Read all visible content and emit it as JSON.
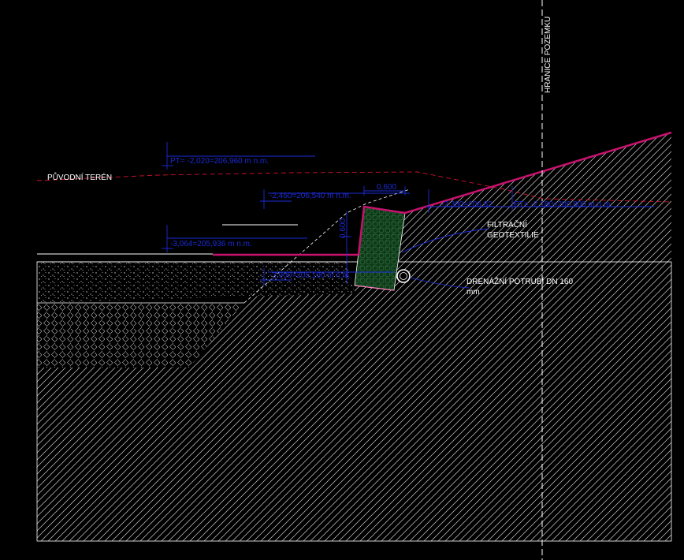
{
  "labels": {
    "boundary": "HRANICE POZEMKU",
    "original_terrain": "PŮVODNÍ TERÉN",
    "filter_line1": "FILTRAČNÍ",
    "filter_line2": "GEOTEXTILIE",
    "drain_line1": "DRENÁŽNÍ POTRUBÍ DN 160",
    "drain_line2": "mm"
  },
  "levels": {
    "pt": "PT= -2,020=206,960 m n.m.",
    "top_wall": "-2,460=206,540 m n.m.",
    "ground_left": "-3,064=205,936 m n.m.",
    "bottom": "-3,900=205,100 m n.m.",
    "right_a": "-2,380=206,62",
    "right_b": "PT= -2,180=206,800 m n.m.",
    "dim_width": "0,600",
    "dim_height": "0,600"
  },
  "colors": {
    "background": "#000000",
    "line_white": "#ffffff",
    "dimension_blue": "#1b2bd6",
    "terrain_magenta": "#c8126e",
    "terrain_dashed_red": "#d0122e",
    "wall_green": "#12401e"
  }
}
